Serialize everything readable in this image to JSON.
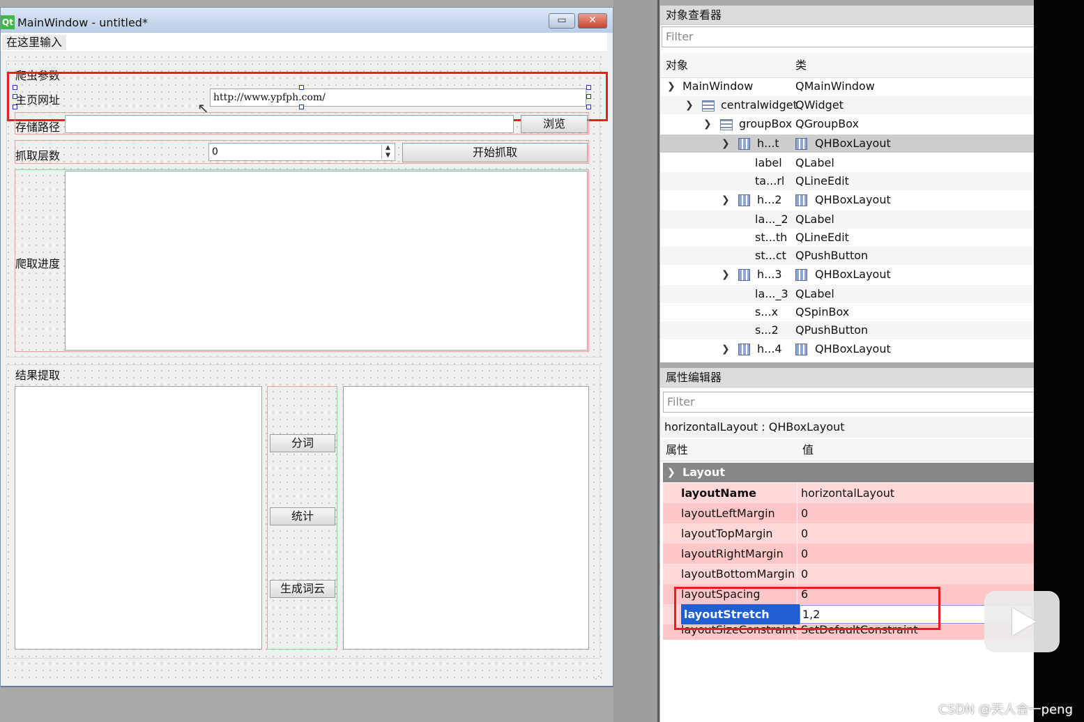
{
  "window": {
    "logo": "Qt",
    "title": "MainWindow - untitled*",
    "minimize_glyph": "▭",
    "close_glyph": "✕"
  },
  "menu": {
    "type_here": "在这里输入"
  },
  "form": {
    "group1_title": "爬虫参数",
    "url_label": "主页网址",
    "url_value": "http://www.ypfph.com/",
    "path_label": "存储路径",
    "browse_button": "浏览",
    "depth_label": "抓取层数",
    "depth_value": "0",
    "start_button": "开始抓取",
    "progress_label": "爬取进度",
    "group2_title": "结果提取",
    "segment_button": "分词",
    "stats_button": "统计",
    "wordcloud_button": "生成词云"
  },
  "object_inspector": {
    "title": "对象查看器",
    "filter_placeholder": "Filter",
    "col_object": "对象",
    "col_class": "类",
    "rows": [
      {
        "name": "MainWindow",
        "cls": "QMainWindow"
      },
      {
        "name": "centralwidget",
        "cls": "QWidget"
      },
      {
        "name": "groupBox",
        "cls": "QGroupBox"
      },
      {
        "name": "h...t",
        "cls": "QHBoxLayout"
      },
      {
        "name": "label",
        "cls": "QLabel"
      },
      {
        "name": "ta...rl",
        "cls": "QLineEdit"
      },
      {
        "name": "h...2",
        "cls": "QHBoxLayout"
      },
      {
        "name": "la..._2",
        "cls": "QLabel"
      },
      {
        "name": "st...th",
        "cls": "QLineEdit"
      },
      {
        "name": "st...ct",
        "cls": "QPushButton"
      },
      {
        "name": "h...3",
        "cls": "QHBoxLayout"
      },
      {
        "name": "la..._3",
        "cls": "QLabel"
      },
      {
        "name": "s...x",
        "cls": "QSpinBox"
      },
      {
        "name": "s...2",
        "cls": "QPushButton"
      },
      {
        "name": "h...4",
        "cls": "QHBoxLayout"
      }
    ]
  },
  "property_editor": {
    "title": "属性编辑器",
    "filter_placeholder": "Filter",
    "object_line": "horizontalLayout : QHBoxLayout",
    "col_property": "属性",
    "col_value": "值",
    "section": "Layout",
    "props": [
      {
        "name": "layoutName",
        "value": "horizontalLayout"
      },
      {
        "name": "layoutLeftMargin",
        "value": "0"
      },
      {
        "name": "layoutTopMargin",
        "value": "0"
      },
      {
        "name": "layoutRightMargin",
        "value": "0"
      },
      {
        "name": "layoutBottomMargin",
        "value": "0"
      },
      {
        "name": "layoutSpacing",
        "value": "6"
      },
      {
        "name": "layoutStretch",
        "value": "1,2"
      },
      {
        "name": "layoutSizeConstraint",
        "value": "SetDefaultConstraint"
      }
    ]
  },
  "watermark": "CSDN @天人合一peng",
  "colors": {
    "highlight_red": "#e81f1f",
    "selection_blue": "#1f5fd1",
    "property_pink": "#ffd9d9",
    "section_gray": "#878787"
  }
}
